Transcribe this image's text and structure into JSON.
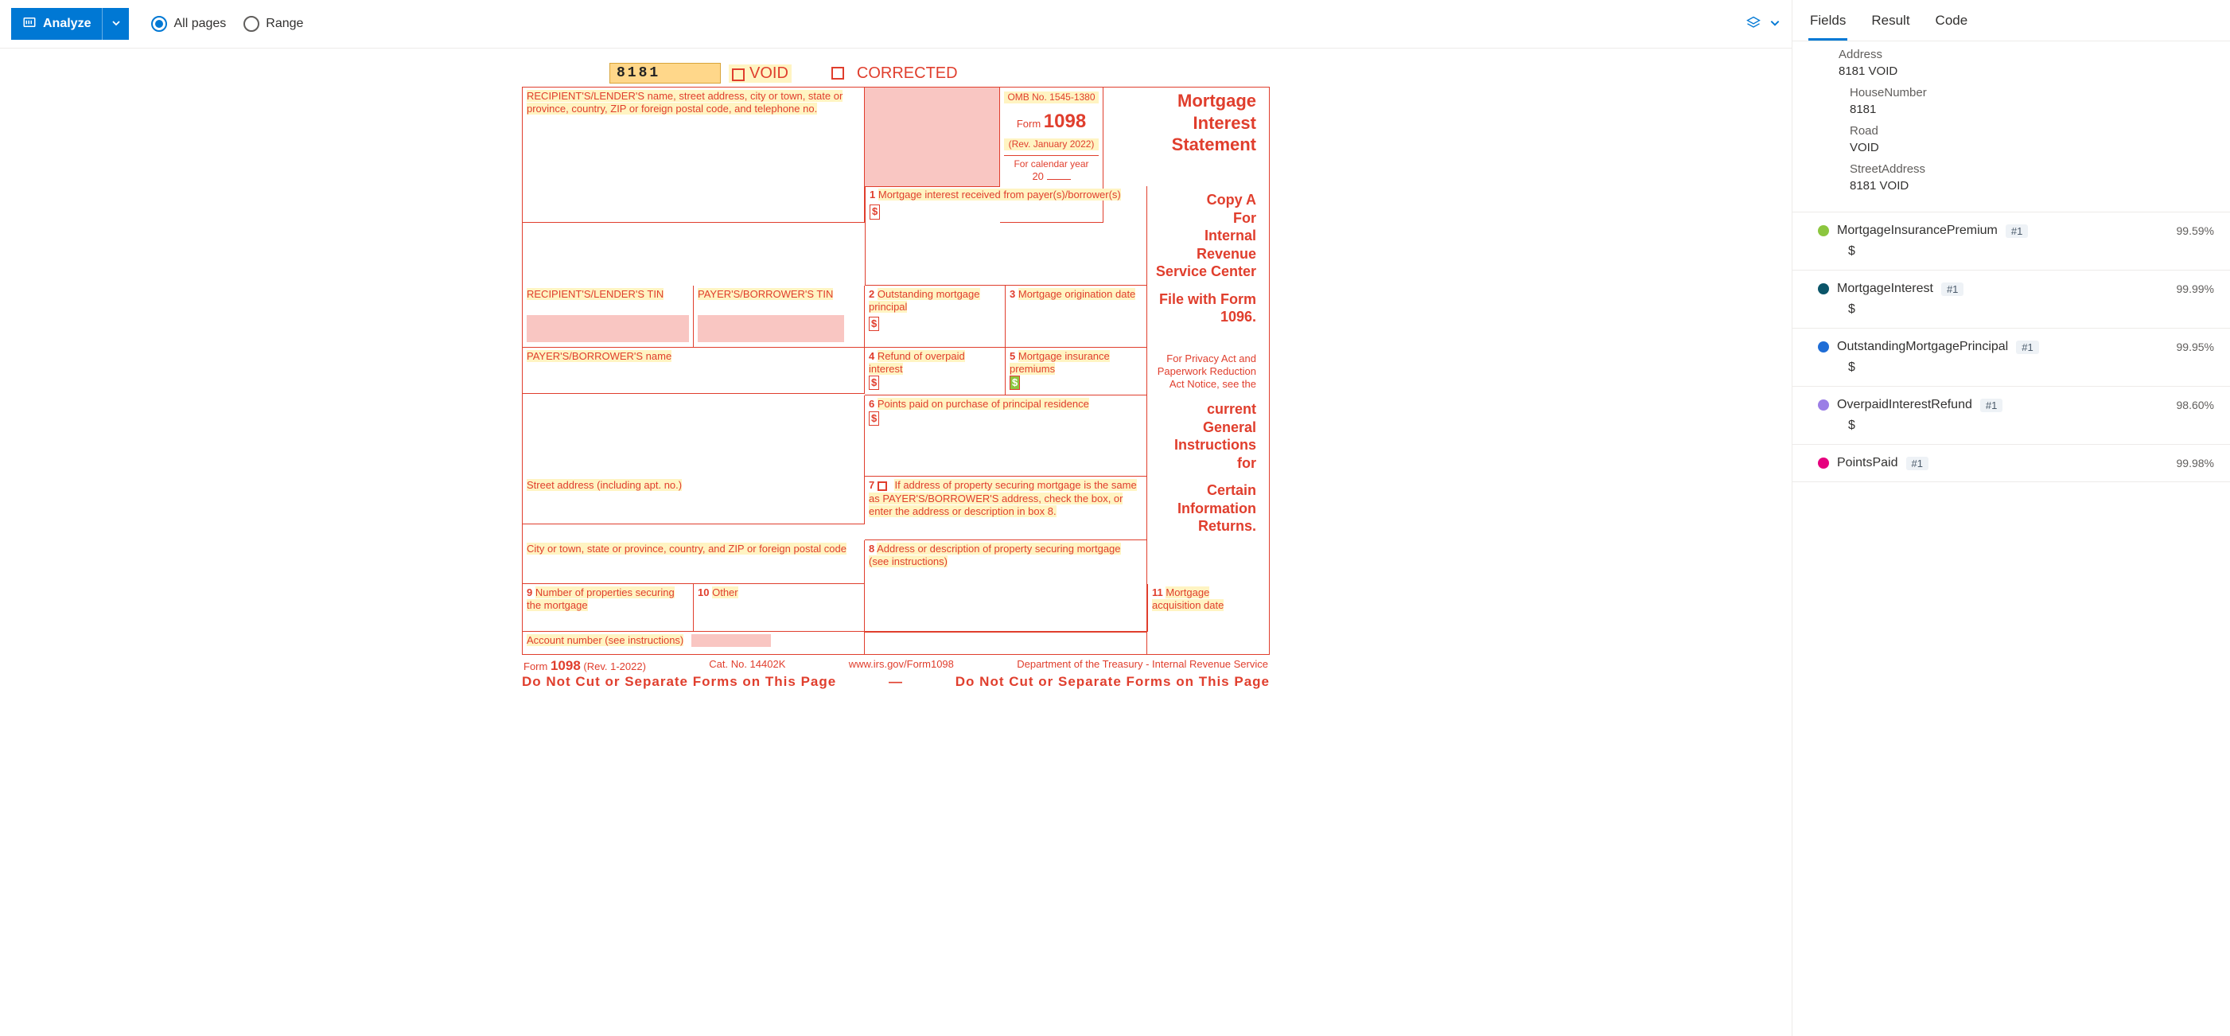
{
  "toolbar": {
    "analyze_label": "Analyze",
    "all_pages_label": "All pages",
    "range_label": "Range"
  },
  "form": {
    "code": "8181",
    "void_label": "VOID",
    "corrected_label": "CORRECTED",
    "recipient_header": "RECIPIENT'S/LENDER'S name, street address, city or town, state or province, country, ZIP or foreign postal code, and telephone no.",
    "omb": "OMB No. 1545-1380",
    "form_label": "Form",
    "form_no": "1098",
    "rev": "(Rev. January 2022)",
    "calendar": "For calendar year",
    "year_prefix": "20",
    "title_line1": "Mortgage",
    "title_line2": "Interest",
    "title_line3": "Statement",
    "box1": "Mortgage interest received from payer(s)/borrower(s)",
    "recipient_tin": "RECIPIENT'S/LENDER'S TIN",
    "payer_tin": "PAYER'S/BORROWER'S TIN",
    "box2": "Outstanding mortgage principal",
    "box3": "Mortgage origination date",
    "box4": "Refund of overpaid interest",
    "box5": "Mortgage insurance premiums",
    "payer_name": "PAYER'S/BORROWER'S name",
    "box6": "Points paid on purchase of principal residence",
    "street": "Street address (including apt. no.)",
    "box7": "If address of property securing mortgage is the same as PAYER'S/BORROWER'S address, check the box, or enter the address or description in box 8.",
    "city": "City or town, state or province, country, and ZIP or foreign postal code",
    "box8": "Address or description of property securing mortgage (see instructions)",
    "box9": "Number of properties securing the mortgage",
    "box10": "Other",
    "box11": "Mortgage acquisition date",
    "account": "Account number (see instructions)",
    "copy_a": "Copy A",
    "copy_for": "For",
    "copy_irs1": "Internal Revenue",
    "copy_irs2": "Service Center",
    "file_with": "File with Form 1096.",
    "notice": "For Privacy Act and Paperwork Reduction Act Notice, see the",
    "notice_b1": "current General",
    "notice_b2": "Instructions for",
    "notice_b3": "Certain",
    "notice_b4": "Information",
    "notice_b5": "Returns.",
    "footer_form": "Form",
    "footer_1098": "1098",
    "footer_rev": "(Rev. 1-2022)",
    "footer_cat": "Cat. No. 14402K",
    "footer_url": "www.irs.gov/Form1098",
    "footer_dept": "Department of the Treasury - Internal Revenue Service",
    "footer_warn_l": "Do  Not  Cut  or  Separate  Forms  on  This  Page",
    "footer_dash": "—",
    "footer_warn_r": "Do  Not  Cut  or  Separate  Forms  on  This  Page"
  },
  "right": {
    "tabs": {
      "fields": "Fields",
      "result": "Result",
      "code": "Code"
    },
    "address": {
      "label": "Address",
      "value": "8181 VOID",
      "house_label": "HouseNumber",
      "house_value": "8181",
      "road_label": "Road",
      "road_value": "VOID",
      "street_label": "StreetAddress",
      "street_value": "8181 VOID"
    },
    "fields": [
      {
        "name": "MortgageInsurancePremium",
        "badge": "#1",
        "conf": "99.59%",
        "value": "$",
        "color": "#8cc63f"
      },
      {
        "name": "MortgageInterest",
        "badge": "#1",
        "conf": "99.99%",
        "value": "$",
        "color": "#0b5569"
      },
      {
        "name": "OutstandingMortgagePrincipal",
        "badge": "#1",
        "conf": "99.95%",
        "value": "$",
        "color": "#1f6dd6"
      },
      {
        "name": "OverpaidInterestRefund",
        "badge": "#1",
        "conf": "98.60%",
        "value": "$",
        "color": "#9b7ee6"
      },
      {
        "name": "PointsPaid",
        "badge": "#1",
        "conf": "99.98%",
        "value": "",
        "color": "#e6007e"
      }
    ]
  }
}
